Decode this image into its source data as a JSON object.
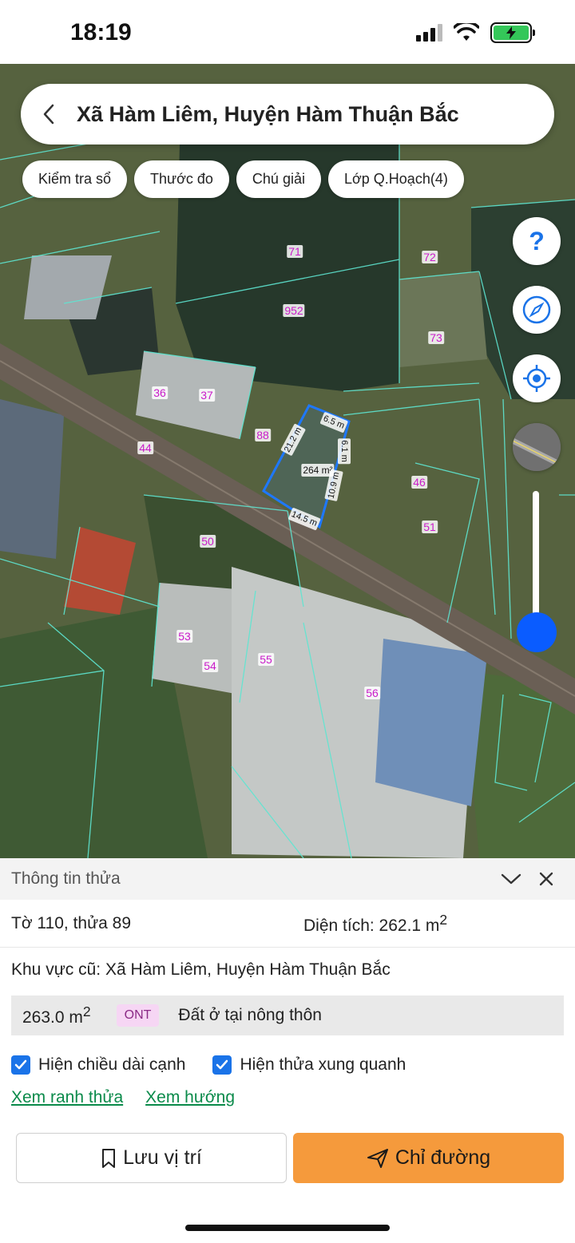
{
  "status": {
    "time": "18:19"
  },
  "search": {
    "title": "Xã Hàm Liêm, Huyện Hàm Thuận Bắc"
  },
  "chips": [
    {
      "label": "Kiểm tra sổ"
    },
    {
      "label": "Thước đo"
    },
    {
      "label": "Chú giải"
    },
    {
      "label": "Lớp Q.Hoạch(4)"
    }
  ],
  "map": {
    "parcels": [
      "71",
      "72",
      "952",
      "73",
      "36",
      "37",
      "88",
      "44",
      "46",
      "51",
      "50",
      "53",
      "54",
      "55",
      "56"
    ],
    "selected": {
      "area": "264 m²",
      "edges": [
        "6.5 m",
        "21.2 m",
        "6.1 m",
        "10.9 m",
        "14.5 m"
      ]
    }
  },
  "sheet": {
    "title": "Thông tin thửa",
    "parcel": "Tờ 110, thửa 89",
    "area_label": "Diện tích: 262.1 m",
    "area_sup": "2",
    "old_area": "Khu vực cũ: Xã Hàm Liêm, Huyện Hàm Thuận Bắc",
    "landuse": {
      "value": "263.0 m",
      "sup": "2",
      "code": "ONT",
      "desc": "Đất ở tại nông thôn"
    },
    "check1": "Hiện chiều dài cạnh",
    "check2": "Hiện thửa xung quanh",
    "link1": "Xem ranh thửa",
    "link2": "Xem hướng",
    "save": "Lưu vị trí",
    "directions": "Chỉ đường"
  },
  "colors": {
    "accent": "#f59a3c",
    "primary_blue": "#1a73e8",
    "link": "#0a8a4a",
    "parcel_label": "#c91bc9"
  }
}
